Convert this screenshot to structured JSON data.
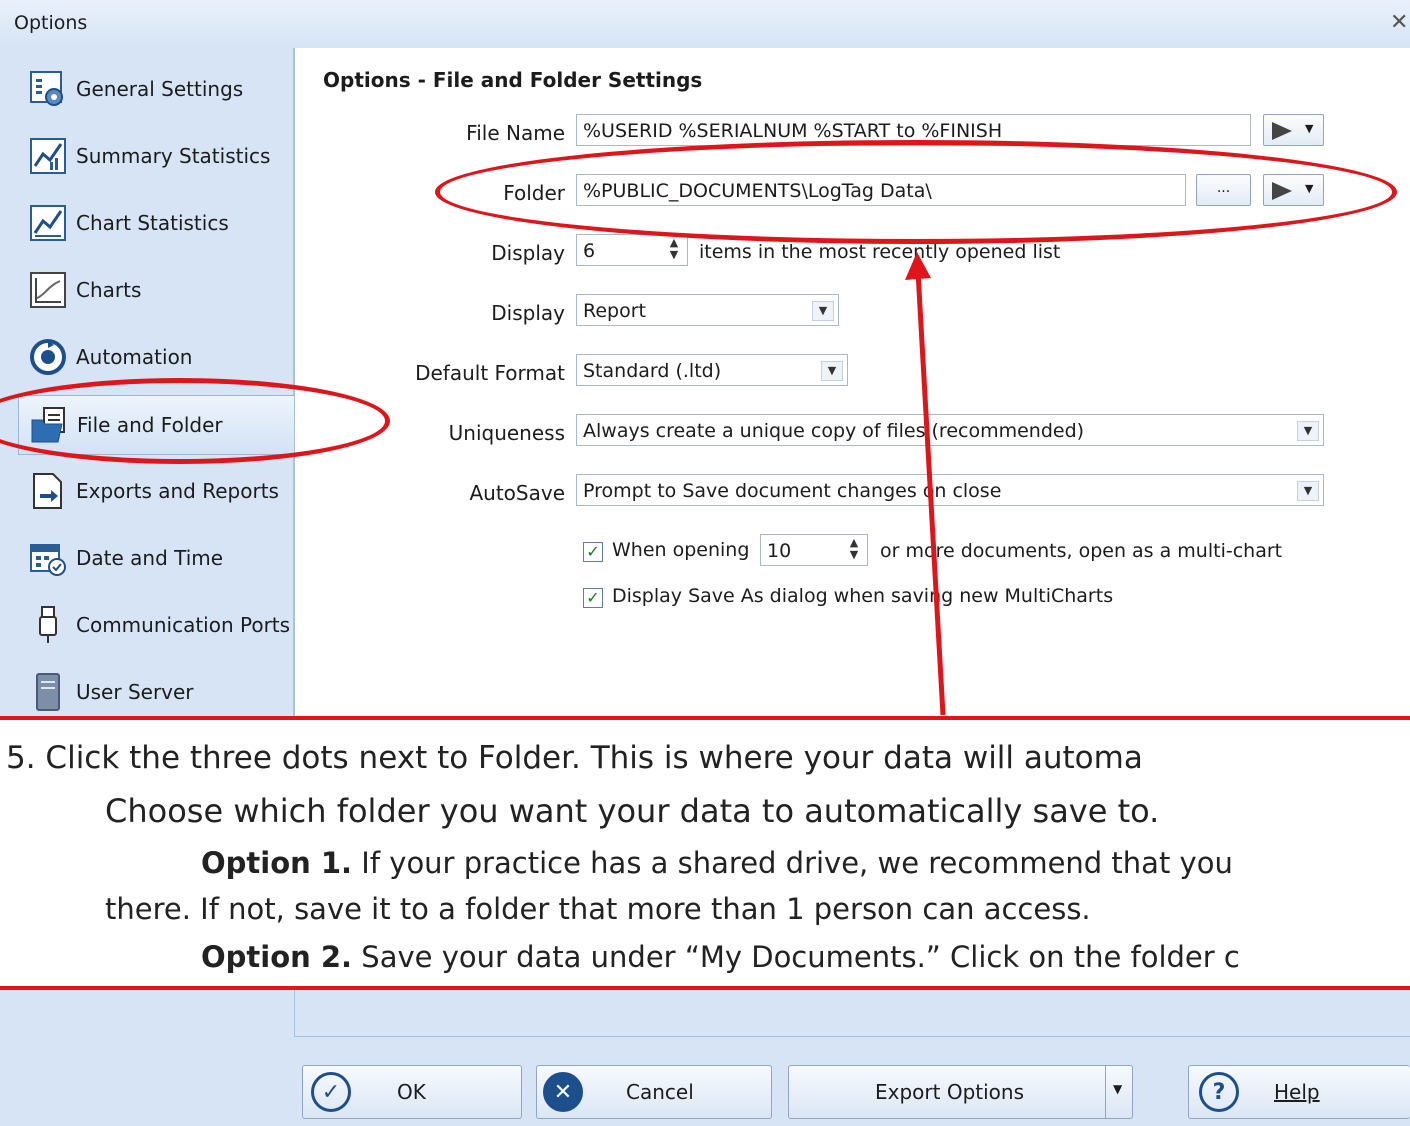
{
  "window": {
    "title": "Options",
    "close_glyph": "✕"
  },
  "sidebar": {
    "items": [
      {
        "label": "General Settings",
        "icon": "general-settings-icon"
      },
      {
        "label": "Summary Statistics",
        "icon": "summary-statistics-icon"
      },
      {
        "label": "Chart Statistics",
        "icon": "chart-statistics-icon"
      },
      {
        "label": "Charts",
        "icon": "charts-icon"
      },
      {
        "label": "Automation",
        "icon": "automation-icon"
      },
      {
        "label": "File and Folder",
        "icon": "file-folder-icon",
        "active": true
      },
      {
        "label": "Exports and Reports",
        "icon": "exports-reports-icon"
      },
      {
        "label": "Date and Time",
        "icon": "date-time-icon"
      },
      {
        "label": "Communication Ports",
        "icon": "usb-icon"
      },
      {
        "label": "User Server",
        "icon": "server-icon"
      }
    ]
  },
  "main": {
    "heading": "Options - File and Folder Settings",
    "file_name": {
      "label": "File Name",
      "value": "%USERID %SERIALNUM %START to %FINISH"
    },
    "folder": {
      "label": "Folder",
      "value": "%PUBLIC_DOCUMENTS\\LogTag Data\\",
      "browse_label": "..."
    },
    "display_count": {
      "label": "Display",
      "value": "6",
      "suffix": "items in the most recently opened list"
    },
    "display_mode": {
      "label": "Display",
      "value": "Report"
    },
    "default_format": {
      "label": "Default Format",
      "value": "Standard (.ltd)"
    },
    "uniqueness": {
      "label": "Uniqueness",
      "value": "Always create a unique copy of files (recommended)"
    },
    "autosave": {
      "label": "AutoSave",
      "value": "Prompt to Save document changes on close"
    },
    "when_opening": {
      "label": "When opening",
      "value": "10",
      "suffix": "or more documents, open as a multi-chart",
      "checked": true
    },
    "save_as_dialog": {
      "label": "Display Save As dialog when saving new MultiCharts",
      "checked": true
    }
  },
  "instructions": {
    "line1": "5. Click the three dots next to Folder. This is where your data will automa",
    "line2": "Choose which folder you want your data to automatically save to.",
    "option1_bold": "Option 1.",
    "option1_text": " If your practice has a shared drive, we recommend that you",
    "line4": "there. If not, save it to a folder that more than 1 person can access.",
    "option2_bold": "Option 2.",
    "option2_text": " Save your data under “My Documents.” Click on the folder c"
  },
  "footer": {
    "ok_label": "OK",
    "cancel_label": "Cancel",
    "export_label": "Export Options",
    "help_label": "Help"
  },
  "colors": {
    "annotation_red": "#e0151a",
    "accent_blue": "#1d4f8c"
  }
}
